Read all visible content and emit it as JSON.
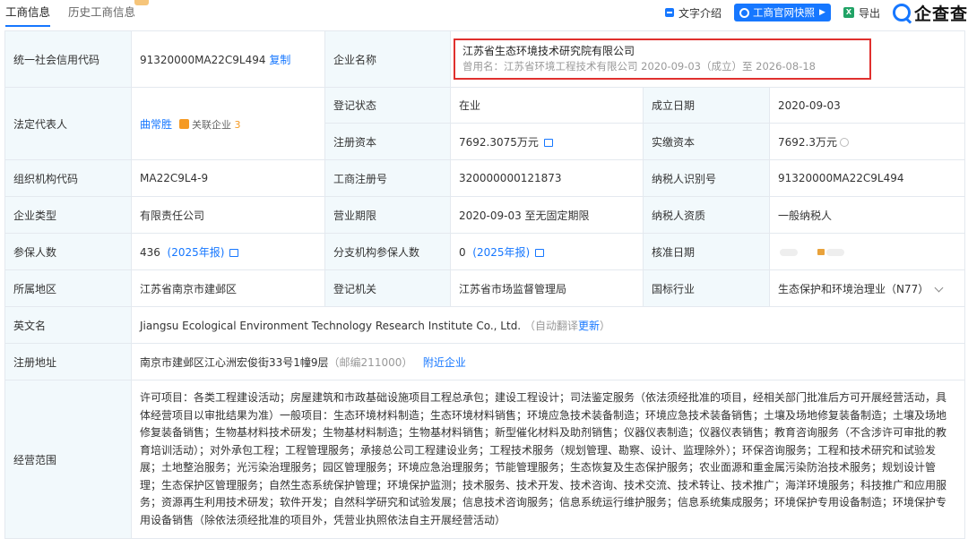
{
  "tabs": [
    "工商信息",
    "历史工商信息"
  ],
  "toolbar": {
    "text_intro": "文字介绍",
    "snapshot": "工商官网快照",
    "export": "导出",
    "logo": "企查查"
  },
  "labels": {
    "credit_code": "统一社会信用代码",
    "company_name": "企业名称",
    "legal_rep": "法定代表人",
    "reg_status": "登记状态",
    "found_date": "成立日期",
    "reg_capital": "注册资本",
    "paid_capital": "实缴资本",
    "org_code": "组织机构代码",
    "biz_reg_no": "工商注册号",
    "taxpayer_id": "纳税人识别号",
    "company_type": "企业类型",
    "biz_term": "营业期限",
    "taxpayer_qual": "纳税人资质",
    "insured_count": "参保人数",
    "branch_insured": "分支机构参保人数",
    "approval_date": "核准日期",
    "region": "所属地区",
    "reg_authority": "登记机关",
    "industry": "国标行业",
    "english_name": "英文名",
    "reg_address": "注册地址",
    "biz_scope": "经营范围"
  },
  "values": {
    "credit_code": "91320000MA22C9L494",
    "copy": "复制",
    "company_name": "江苏省生态环境技术研究院有限公司",
    "former_name": "曾用名：江苏省环境工程技术有限公司 2020-09-03（成立）至 2026-08-18",
    "legal_rep": "曲常胜",
    "related_prefix": "关联企业",
    "related_count": "3",
    "reg_status": "在业",
    "found_date": "2020-09-03",
    "reg_capital": "7692.3075万元",
    "paid_capital": "7692.3万元",
    "org_code": "MA22C9L4-9",
    "biz_reg_no": "320000000121873",
    "taxpayer_id": "91320000MA22C9L494",
    "company_type": "有限责任公司",
    "biz_term": "2020-09-03 至无固定期限",
    "taxpayer_qual": "一般纳税人",
    "insured_count": "436",
    "insured_year": "(2025年报)",
    "branch_insured": "0",
    "branch_year": "(2025年报)",
    "region": "江苏省南京市建邺区",
    "reg_authority": "江苏省市场监督管理局",
    "industry": "生态保护和环境治理业（N77）",
    "english_name": "Jiangsu Ecological Environment Technology Research Institute Co., Ltd.",
    "auto_translate": "（自动翻译",
    "update": "更新",
    "close_paren": "）",
    "address": "南京市建邺区江心洲宏俊街33号1幢9层",
    "postcode": "（邮编211000）",
    "nearby": "附近企业",
    "biz_scope": "许可项目：各类工程建设活动；房屋建筑和市政基础设施项目工程总承包；建设工程设计；司法鉴定服务（依法须经批准的项目，经相关部门批准后方可开展经营活动，具体经营项目以审批结果为准）一般项目：生态环境材料制造；生态环境材料销售；环境应急技术装备制造；环境应急技术装备销售；土壤及场地修复装备制造；土壤及场地修复装备销售；生物基材料技术研发；生物基材料制造；生物基材料销售；新型催化材料及助剂销售；仪器仪表制造；仪器仪表销售；教育咨询服务（不含涉许可审批的教育培训活动）；对外承包工程；工程管理服务；承接总公司工程建设业务；工程技术服务（规划管理、勘察、设计、监理除外）；环保咨询服务；工程和技术研究和试验发展；土地整治服务；光污染治理服务；园区管理服务；环境应急治理服务；节能管理服务；生态恢复及生态保护服务；农业面源和重金属污染防治技术服务；规划设计管理；生态保护区管理服务；自然生态系统保护管理；环境保护监测；技术服务、技术开发、技术咨询、技术交流、技术转让、技术推广；海洋环境服务；科技推广和应用服务；资源再生利用技术研发；软件开发；自然科学研究和试验发展；信息技术咨询服务；信息系统运行维护服务；信息系统集成服务；环境保护专用设备制造；环境保护专用设备销售（除依法须经批准的项目外，凭营业执照依法自主开展经营活动）"
  }
}
